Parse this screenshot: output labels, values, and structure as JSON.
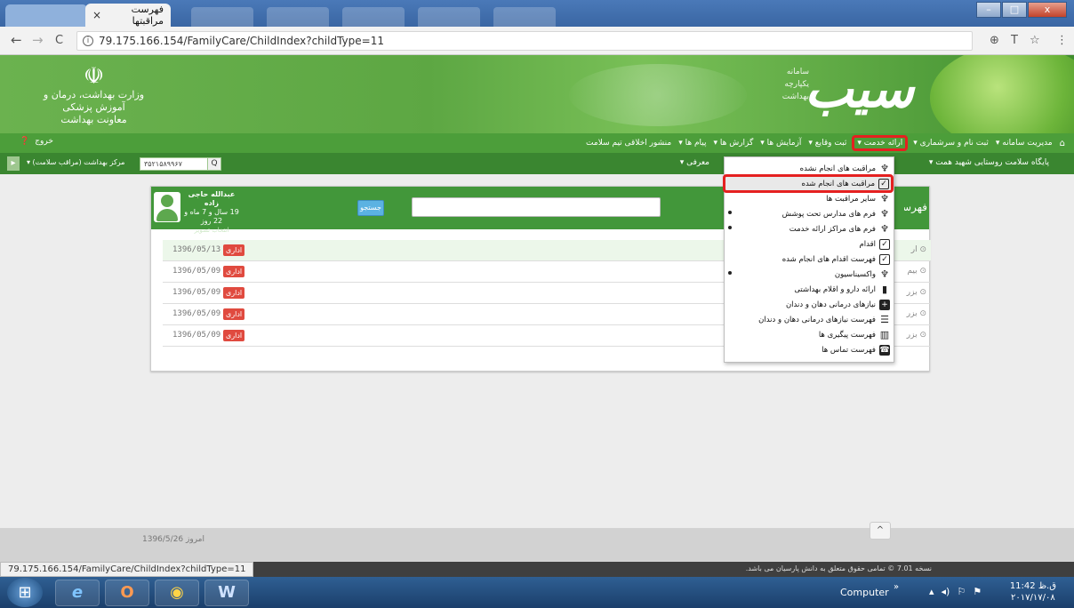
{
  "browser": {
    "tab_title": "فهرست مراقبتها",
    "tab_close": "×",
    "url": "79.175.166.154/FamilyCare/ChildIndex?childType=11",
    "back": "←",
    "forward": "→",
    "reload": "C",
    "zoom": "⊕",
    "translate": "T",
    "star": "☆",
    "more": "⋮",
    "win_min": "–",
    "win_max": "□",
    "win_close": "x"
  },
  "header": {
    "ministry_emblem": "☫",
    "ministry_line1": "وزارت بهداشت، درمان و آموزش پزشکی",
    "ministry_line2": "معاونت بهداشت",
    "brand_title": "سیب",
    "brand_sub": [
      "سامانه",
      "یکپارچه",
      "بهداشت"
    ]
  },
  "main_menu": {
    "home_icon": "⌂",
    "items": [
      "مدیریت سامانه ▾",
      "ثبت نام و سرشماری ▾",
      "ارائه خدمت ▾",
      "ثبت وقایع ▾",
      "آزمایش ها ▾",
      "گزارش ها ▾",
      "پیام ها ▾",
      "منشور اخلاقی تیم سلامت"
    ],
    "logout": "خروج",
    "help": "❓"
  },
  "subbar": {
    "center": "پایگاه سلامت روستایی شهید همت ▾",
    "service": "خدمت گیرنده",
    "service_tail": "معرفی ▾",
    "search_value": "۳۵۲۱۵۸۹۹۶۷",
    "search_icon": "🔍",
    "health_worker": "مرکز بهداشت (مراقب سلامت) ▾",
    "left_btn": "▸"
  },
  "patient": {
    "name": "عبدالله حاجی زاده",
    "age": "19 سال و 7 ماه و 22 روز",
    "photo_link": "انتخاب تصویر"
  },
  "panel": {
    "title": "فهرست مراقبت ها",
    "search_button": "جستجو",
    "search_placeholder": "",
    "rows": [
      {
        "date": "1396/05/13",
        "badge": "اداری",
        "right": "⊙ ار"
      },
      {
        "date": "1396/05/09",
        "badge": "اداری",
        "right": "⊙ بیم"
      },
      {
        "date": "1396/05/09",
        "badge": "اداری",
        "right": "⊙ بزر"
      },
      {
        "date": "1396/05/09",
        "badge": "اداری",
        "right": "⊙ بزر"
      },
      {
        "date": "1396/05/09",
        "badge": "اداری",
        "right": "⊙ بزر"
      }
    ]
  },
  "dropdown": {
    "items": [
      {
        "label": "مراقبت های انجام نشده",
        "icon": "stethoscope-icon",
        "glyph": "♆",
        "style": "plain",
        "caret": false,
        "highlight": false
      },
      {
        "label": "مراقبت های انجام شده",
        "icon": "check-square-icon",
        "glyph": "✓",
        "style": "box",
        "caret": false,
        "highlight": true
      },
      {
        "label": "سایر مراقبت ها",
        "icon": "stethoscope-icon",
        "glyph": "♆",
        "style": "plain",
        "caret": false,
        "highlight": false
      },
      {
        "label": "فرم های مدارس تحت پوشش",
        "icon": "stethoscope-icon",
        "glyph": "♆",
        "style": "plain",
        "caret": true,
        "highlight": false
      },
      {
        "label": "فرم های مراکز ارائه خدمت",
        "icon": "stethoscope-icon",
        "glyph": "♆",
        "style": "plain",
        "caret": true,
        "highlight": false
      },
      {
        "label": "اقدام",
        "icon": "check-square-icon",
        "glyph": "✓",
        "style": "box",
        "caret": false,
        "highlight": false
      },
      {
        "label": "فهرست اقدام های انجام شده",
        "icon": "check-square-icon",
        "glyph": "✓",
        "style": "box",
        "caret": false,
        "highlight": false
      },
      {
        "label": "واکسیناسیون",
        "icon": "stethoscope-icon",
        "glyph": "♆",
        "style": "plain",
        "caret": true,
        "highlight": false
      },
      {
        "label": "ارائه دارو و اقلام بهداشتی",
        "icon": "file-icon",
        "glyph": "▮",
        "style": "plain",
        "caret": false,
        "highlight": false
      },
      {
        "label": "نیازهای درمانی دهان و دندان",
        "icon": "plus-square-icon",
        "glyph": "+",
        "style": "fill",
        "caret": false,
        "highlight": false
      },
      {
        "label": "فهرست نیازهای درمانی دهان و دندان",
        "icon": "list-icon",
        "glyph": "☰",
        "style": "plain",
        "caret": false,
        "highlight": false
      },
      {
        "label": "فهرست پیگیری ها",
        "icon": "bar-chart-icon",
        "glyph": "▥",
        "style": "plain",
        "caret": false,
        "highlight": false
      },
      {
        "label": "فهرست تماس ها",
        "icon": "phone-icon",
        "glyph": "☎",
        "style": "fill",
        "caret": false,
        "highlight": false
      }
    ]
  },
  "footer": {
    "date": "امروز 1396/5/26",
    "scroll_top": "^",
    "status_url": "79.175.166.154/FamilyCare/ChildIndex?childType=11",
    "version": "نسخه 7.01 © تمامی حقوق متعلق به دانش پارسیان می باشد."
  },
  "taskbar": {
    "start": "⊞",
    "apps": [
      "e",
      "O",
      "◉",
      "W"
    ],
    "computer": "Computer",
    "tray": "»",
    "tray_icons": [
      "▴",
      "◂)",
      "⚐",
      "⚑"
    ],
    "time": "11:42 ق.ظ",
    "date": "۲۰۱۷/۱۷/۰۸"
  }
}
